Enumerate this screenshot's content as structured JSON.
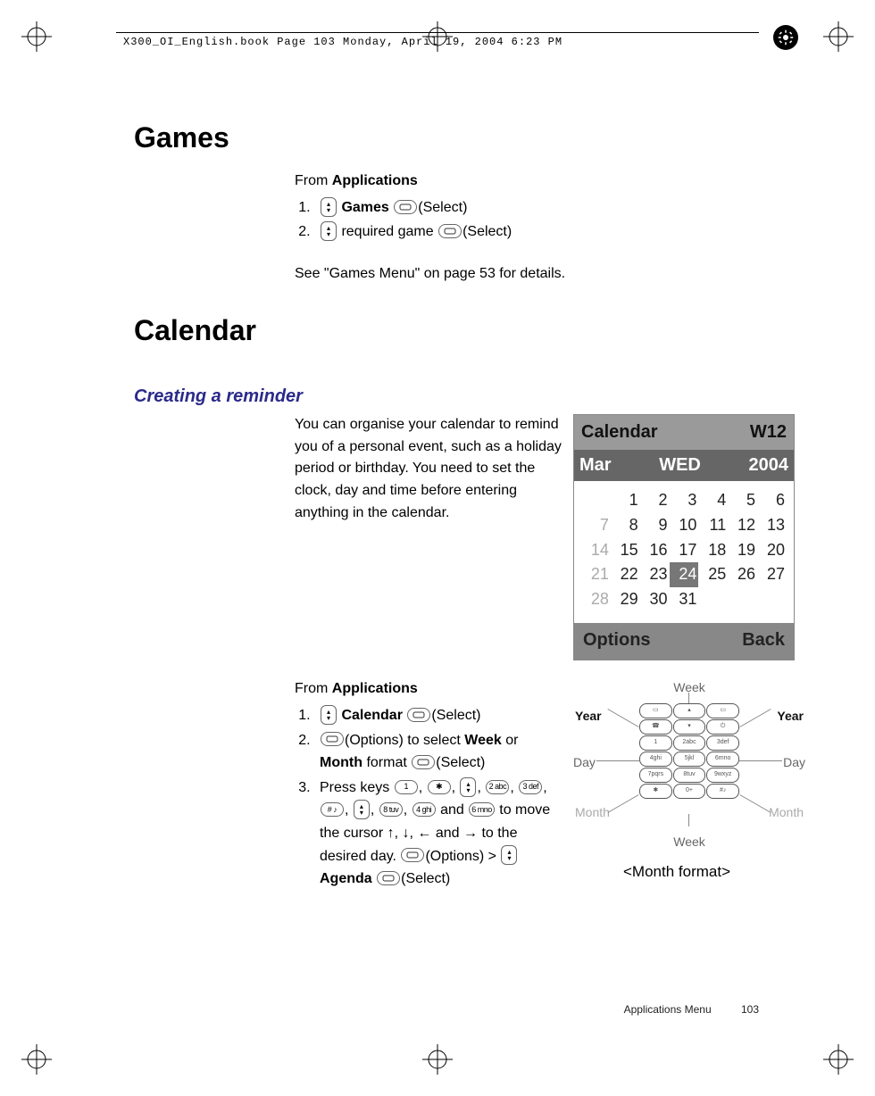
{
  "header": {
    "filestamp": "X300_OI_English.book  Page 103  Monday, April 19, 2004  6:23 PM"
  },
  "games": {
    "heading": "Games",
    "from_line": "From",
    "from_bold": "Applications",
    "step1_bold": "Games",
    "step1_paren": "(Select)",
    "step2_text": "required game",
    "step2_paren": "(Select)",
    "note": "See \"Games Menu\" on page 53 for details."
  },
  "calendar": {
    "heading": "Calendar",
    "subheading": "Creating a reminder",
    "intro": "You can organise your calendar to remind you of a personal event, such as a holiday period or birthday. You need to set the clock, day and time before entering anything in the calendar.",
    "from_line": "From",
    "from_bold": "Applications",
    "step1_bold": "Calendar",
    "step1_paren": "(Select)",
    "step2_pretext": "(Options) to select",
    "step2_week": "Week",
    "step2_or": "or",
    "step2_month": "Month",
    "step2_format": "format",
    "step2_paren": "(Select)",
    "step3_prefix": "Press keys",
    "step3_mid": "and",
    "step3_to_move": "to move the cursor",
    "step3_arrows_and": "and",
    "step3_to_desired": "to the desired day.",
    "step3_options": "(Options) >",
    "step3_agenda": "Agenda",
    "step3_select": "(Select)"
  },
  "screen": {
    "title_left": "Calendar",
    "title_right": "W12",
    "sub_month": "Mar",
    "sub_day": "WED",
    "sub_year": "2004",
    "weeks": [
      "7",
      "14",
      "21",
      "28"
    ],
    "rows": [
      [
        "",
        "1",
        "2",
        "3",
        "4",
        "5",
        "6"
      ],
      [
        "",
        "8",
        "9",
        "10",
        "11",
        "12",
        "13"
      ],
      [
        "",
        "15",
        "16",
        "17",
        "18",
        "19",
        "20"
      ],
      [
        "",
        "22",
        "23",
        "24",
        "25",
        "26",
        "27"
      ],
      [
        "",
        "29",
        "30",
        "31",
        "",
        "",
        ""
      ]
    ],
    "row2_first": "7",
    "row3_first": "14",
    "row4_first": "21",
    "row5_first": "28",
    "highlight": "24",
    "opt_left": "Options",
    "opt_right": "Back"
  },
  "keypad": {
    "label_week": "Week",
    "label_day": "Day",
    "label_year": "Year",
    "label_month": "Month",
    "caption": "<Month format>"
  },
  "footer": {
    "section": "Applications Menu",
    "page": "103"
  }
}
